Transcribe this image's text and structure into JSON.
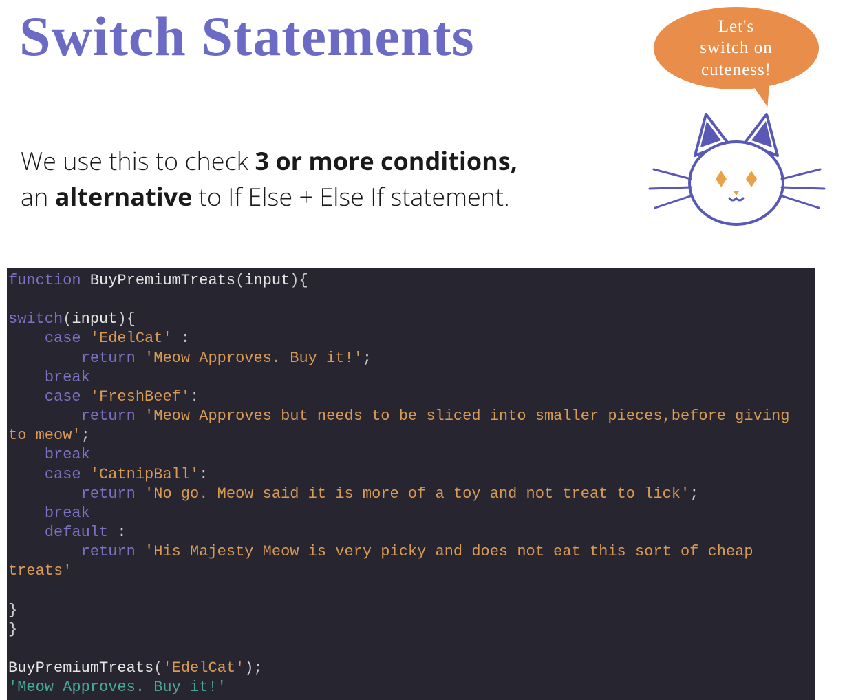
{
  "page": {
    "title": "Switch Statements",
    "desc_line1_pre": "We use this  to  check  ",
    "desc_line1_bold": "3 or more conditions,",
    "desc_line2_pre": "an ",
    "desc_line2_bold": "alternative",
    "desc_line2_post": " to If Else + Else If statement.",
    "bubble": "Let's\nswitch on\ncuteness!"
  },
  "code": {
    "tokens": {
      "function_kw": "function",
      "fn_name": " BuyPremiumTreats",
      "fn_params_open": "(",
      "fn_param_input": "input",
      "fn_params_close": ")",
      "brace_open": "{",
      "switch_kw": "switch",
      "paren_open": "(",
      "switch_arg": "input",
      "paren_close": ")",
      "case_kw": "case",
      "str_edelcat": "'EdelCat'",
      "colon": " :",
      "colon2": ":",
      "return_kw": "return",
      "ret_edelcat": " 'Meow Approves. Buy it!'",
      "semi": ";",
      "break_kw": "break",
      "str_freshbeef": "'FreshBeef'",
      "ret_freshbeef_a": " 'Meow Approves but needs to be sliced into smaller pieces,before giving to meow'",
      "str_catnip": "'CatnipBall'",
      "ret_catnip": " 'No go. Meow said it is more of a toy and not treat to lick'",
      "default_kw": "default",
      "ret_default": " 'His Majesty Meow is very picky and does not eat this sort of cheap treats'",
      "brace_close": "}",
      "call_line_name": "BuyPremiumTreats",
      "call_arg": "'EdelCat'",
      "result": "'Meow Approves. Buy it!'"
    }
  }
}
